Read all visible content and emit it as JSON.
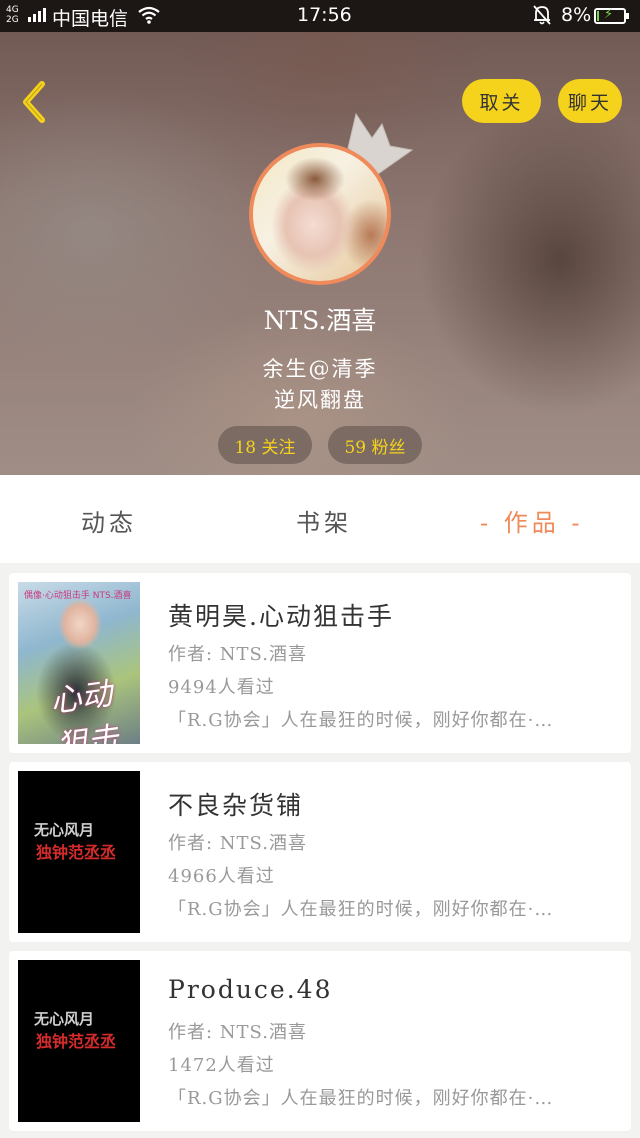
{
  "status_bar": {
    "network_top": "4G",
    "network_bottom": "2G",
    "carrier": "中国电信",
    "time": "17:56",
    "battery_percent": "8%",
    "battery_level": 0.08
  },
  "header": {
    "actions": {
      "unfollow_label": "取关",
      "chat_label": "聊天"
    },
    "nickname": "NTS.酒喜",
    "bio_line1": "余生@清季",
    "bio_line2": "逆风翻盘",
    "stats": {
      "following": "18 关注",
      "fans": "59 粉丝"
    },
    "colors": {
      "accent_yellow": "#f5d21c",
      "avatar_ring": "#ef8a5a"
    }
  },
  "tabs": [
    {
      "label": "动态"
    },
    {
      "label": "书架"
    },
    {
      "label": "- 作品 -",
      "active": true
    }
  ],
  "works": [
    {
      "title": "黄明昊.心动狙击手",
      "author": "作者: NTS.酒喜",
      "views": "9494人看过",
      "description": "「R.G协会」人在最狂的时候，刚好你都在·…",
      "cover": {
        "top_text": "偶像·心动狙击手 NTS.酒喜",
        "script_text": "心动 狙击手"
      }
    },
    {
      "title": "不良杂货铺",
      "author": "作者: NTS.酒喜",
      "views": "4966人看过",
      "description": "「R.G协会」人在最狂的时候，刚好你都在·…",
      "cover": {
        "line1": "无心风月",
        "line2": "独钟范丞丞"
      }
    },
    {
      "title": "Produce.48",
      "author": "作者: NTS.酒喜",
      "views": "1472人看过",
      "description": "「R.G协会」人在最狂的时候，刚好你都在·…",
      "cover": {
        "line1": "无心风月",
        "line2": "独钟范丞丞"
      }
    }
  ],
  "icons": [
    "signal-icon",
    "wifi-icon",
    "mute-bell-icon",
    "battery-icon",
    "back-chevron-icon",
    "crown-icon"
  ]
}
